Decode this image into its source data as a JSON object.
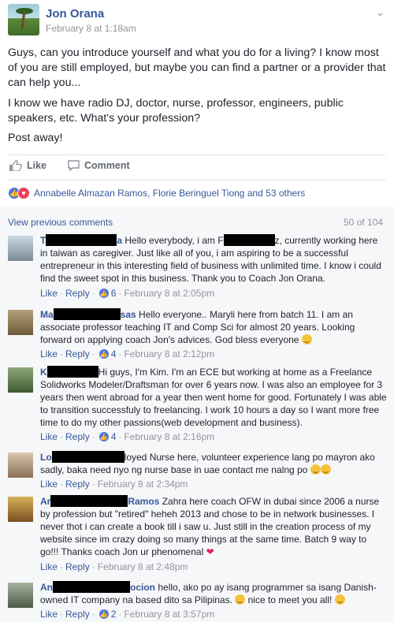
{
  "post": {
    "author": "Jon Orana",
    "timestamp": "February 8 at 1:18am",
    "paragraph1": "Guys, can you introduce yourself and what you do for a living? I know most of you are still employed, but maybe you can find a partner or a provider that can help you...",
    "paragraph2": "I know we have radio DJ, doctor, nurse, professor, engineers, public speakers, etc. What's your profession?",
    "paragraph3": "Post away!"
  },
  "actions": {
    "like": "Like",
    "comment": "Comment"
  },
  "reactions": {
    "text": "Annabelle Almazan Ramos, Florie Beringuel Tiong and 53 others"
  },
  "comments_header": {
    "view_previous": "View previous comments",
    "count": "50 of 104"
  },
  "meta_labels": {
    "like": "Like",
    "reply": "Reply",
    "sep": "·"
  },
  "comments": [
    {
      "name_start": "T",
      "name_end": "a",
      "text": "Hello everybody, i am F",
      "text_after": "z, currently working here in taiwan as caregiver. Just like all of you, i am aspiring to be a successful entrepreneur in this interesting field of business with unlimited time. I know i could find the sweet spot in this business. Thank you to Coach Jon Orana.",
      "likes": "6",
      "time": "February 8 at 2:05pm"
    },
    {
      "name_start": "Ma",
      "name_end": "sas",
      "text": "Hello everyone.. Maryli here from batch 11. I am an associate professor teaching IT and Comp Sci for almost 20 years. Looking forward on applying coach Jon's advices. God bless everyone",
      "likes": "4",
      "time": "February 8 at 2:12pm"
    },
    {
      "name_start": "K",
      "text": "Hi guys, I'm Kim. I'm an ECE but working at home as a Freelance Solidworks Modeler/Draftsman for over 6 years now. I was also an employee for 3 years then went abroad for a year then went home for good. Fortunately I was able to transition successfuly to freelancing. I work 10 hours a day so I want more free time to do my other passions(web development and business).",
      "likes": "4",
      "time": "February 8 at 2:16pm"
    },
    {
      "name_start": "Lo",
      "text": "loyed Nurse here, volunteer experience lang po mayron ako sadly, baka need nyo ng nurse base in uae contact me nalng po",
      "likes": "",
      "time": "February 8 at 2:34pm"
    },
    {
      "name_start": "Ar",
      "name_end": "Ramos",
      "text": "Zahra here coach OFW in dubai since 2006 a nurse by profession but \"retired\" heheh 2013 and chose to be in network businesses. I never thot i can create a book till i saw u. Just still in the creation process of my website since im crazy doing so many things at the same time. Batch 9 way to go!!! Thanks coach Jon ur phenomenal",
      "likes": "",
      "time": "February 8 at 2:48pm"
    },
    {
      "name_start": "An",
      "name_end": "ocion",
      "text": "hello, ako po ay isang programmer sa isang Danish-owned IT company na based dito sa Pilipinas.",
      "text_after": "nice to meet you all!",
      "likes": "2",
      "time": "February 8 at 3:57pm"
    }
  ],
  "colors": {
    "link": "#365899",
    "muted": "#90949c",
    "like_blue": "#4a76e8",
    "background": "#f6f7f9"
  }
}
